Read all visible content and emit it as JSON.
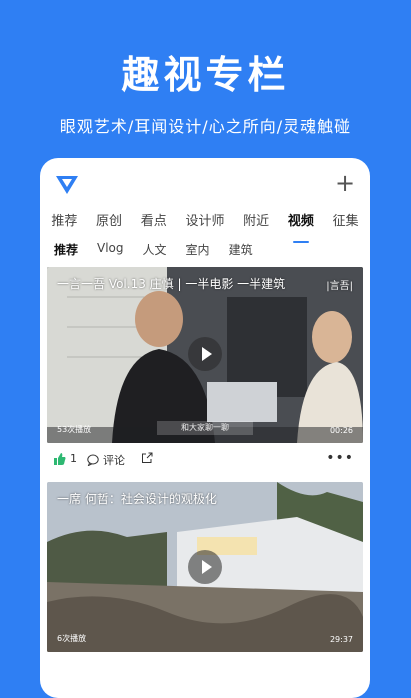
{
  "hero": {
    "title": "趣视专栏",
    "subtitle": "眼观艺术/耳闻设计/心之所向/灵魂触碰"
  },
  "app": {
    "brand_color": "#2f7ff3",
    "tabs": [
      "推荐",
      "原创",
      "看点",
      "设计师",
      "附近",
      "视频",
      "征集"
    ],
    "active_tab": "视频",
    "subtabs": [
      "推荐",
      "Vlog",
      "人文",
      "室内",
      "建筑"
    ],
    "active_subtab": "推荐"
  },
  "videos": [
    {
      "title": "一言一吾 Vol.13 庄慎 | 一半电影 一半建筑",
      "watermark": "|言吾|",
      "caption": "和大家聊一聊",
      "views": "53次播放",
      "duration": "00:26",
      "likes": "1",
      "comment_label": "评论"
    },
    {
      "title": "一席 何哲：社会设计的观极化",
      "views": "6次播放",
      "duration": "29:37"
    }
  ]
}
